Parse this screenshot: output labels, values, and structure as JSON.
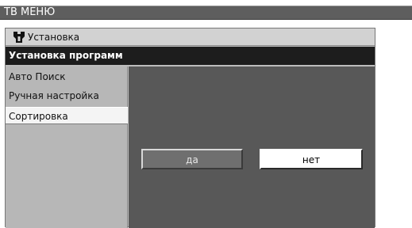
{
  "window": {
    "title": "ТВ МЕНЮ"
  },
  "section": {
    "icon": "tools-icon",
    "label": "Установка"
  },
  "sub_header": {
    "label": "Установка программ"
  },
  "menu": {
    "items": [
      {
        "label": "Авто Поиск",
        "selected": false
      },
      {
        "label": "Ручная настройка",
        "selected": false
      },
      {
        "label": "Сортировка",
        "selected": true
      }
    ]
  },
  "dialog": {
    "yes_label": "да",
    "no_label": "нет"
  }
}
